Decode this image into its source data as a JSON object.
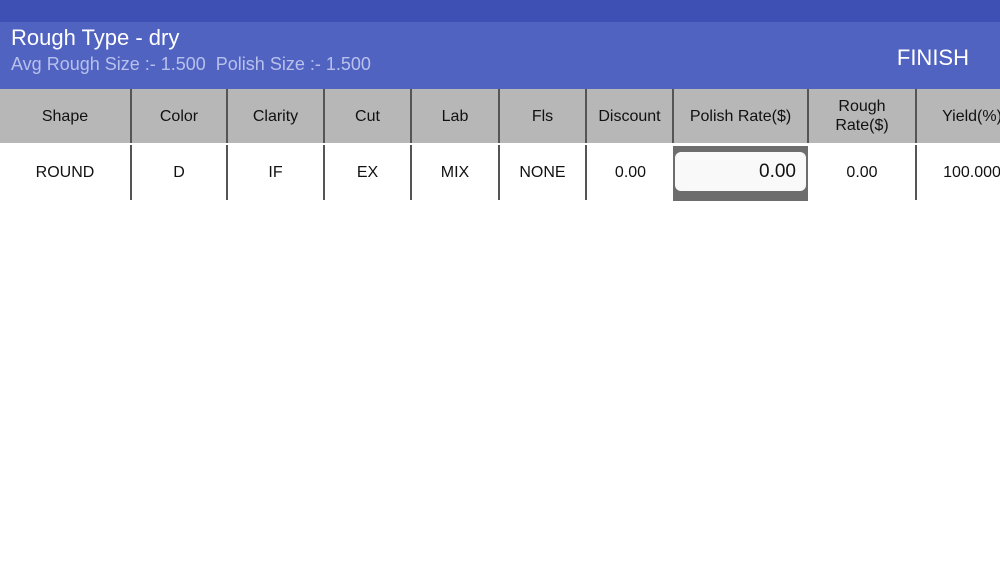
{
  "header": {
    "title": "Rough Type - dry",
    "subtitle": "Avg Rough Size :- 1.500  Polish Size :- 1.500",
    "finish_label": "FINISH"
  },
  "table": {
    "columns": [
      "Shape",
      "Color",
      "Clarity",
      "Cut",
      "Lab",
      "Fls",
      "Discount",
      "Polish Rate($)",
      "Rough\nRate($)",
      "Yield(%)"
    ],
    "rows": [
      {
        "shape": "ROUND",
        "color": "D",
        "clarity": "IF",
        "cut": "EX",
        "lab": "MIX",
        "fls": "NONE",
        "discount": "0.00",
        "polish_rate": "0.00",
        "rough_rate": "0.00",
        "yield": "100.000"
      }
    ]
  },
  "colors": {
    "status_bar": "#3e50b4",
    "header": "#5163c1",
    "table_header": "#b7b7b7",
    "selected_cell": "#6d6d6d"
  }
}
